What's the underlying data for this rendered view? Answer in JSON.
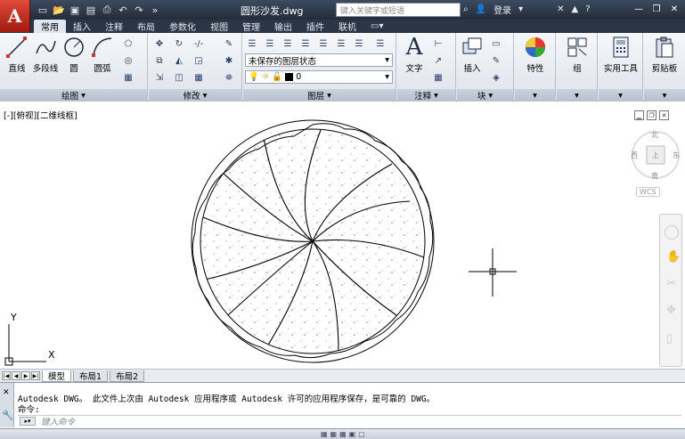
{
  "titlebar": {
    "document_title": "圆形沙发.dwg",
    "search_placeholder": "键入关键字或短语",
    "login_label": "登录",
    "help_icon": "question-icon"
  },
  "ribbon_tabs": [
    "常用",
    "插入",
    "注释",
    "布局",
    "参数化",
    "视图",
    "管理",
    "输出",
    "插件",
    "联机"
  ],
  "ribbon_active_tab": "常用",
  "draw_panel": {
    "title": "绘图",
    "tools": [
      "直线",
      "多段线",
      "圆",
      "圆弧"
    ]
  },
  "modify_panel": {
    "title": "修改"
  },
  "layers_panel": {
    "title": "图层",
    "layer_state": "未保存的图层状态",
    "current_layer": "0"
  },
  "annotation_panel": {
    "title": "注释",
    "text_label": "文字"
  },
  "block_panel": {
    "title": "块",
    "insert_label": "插入"
  },
  "properties_panel": {
    "label": "特性"
  },
  "groups_panel": {
    "label": "组"
  },
  "utilities_panel": {
    "label": "实用工具"
  },
  "clipboard_panel": {
    "label": "剪贴板"
  },
  "viewport": {
    "label": "[-][俯视][二维线框]",
    "viewcube": {
      "north": "北",
      "south": "南",
      "east": "东",
      "west": "西",
      "top": "上",
      "wcs": "WCS"
    },
    "ucs_x": "X",
    "ucs_y": "Y"
  },
  "layout_tabs": [
    "模型",
    "布局1",
    "布局2"
  ],
  "active_layout_tab": "模型",
  "command_history": [
    "Autodesk DWG。  此文件上次由 Autodesk 应用程序或 Autodesk 许可的应用程序保存，是可靠的 DWG。",
    "命令:"
  ],
  "command_input_placeholder": "键入命令",
  "colors": {
    "accent": "#c4291c",
    "titlebar": "#2b3545"
  }
}
